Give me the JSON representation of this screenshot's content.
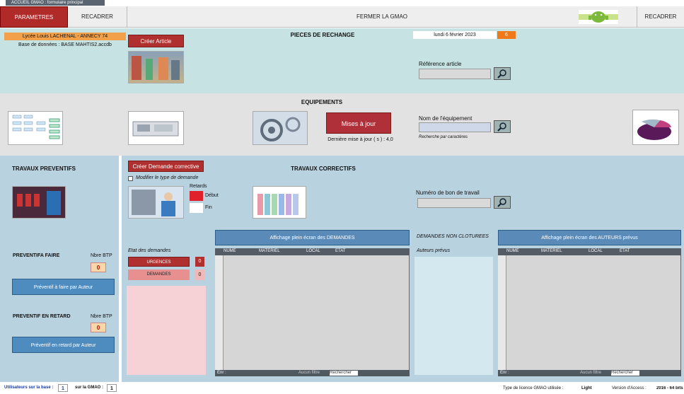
{
  "window": {
    "tab_title": "ACCUEIL GMAO : formulaire principal"
  },
  "topbar": {
    "parametres": "PARAMETRES",
    "recadrer_left": "RECADRER",
    "fermer": "FERMER LA GMAO",
    "recadrer_right": "RECADRER"
  },
  "header": {
    "school": "Lycée Louis LACHENAL - ANNECY 74",
    "db": "Base de données : BASE MAHTIS2.accdb",
    "date": "lundi 6 février 2023",
    "date_badge": "6"
  },
  "pieces": {
    "title": "PIECES DE RECHANGE",
    "create_btn": "Créer Article",
    "ref_label": "Référence article"
  },
  "equip": {
    "title": "EQUIPEMENTS",
    "maj_btn": "Mises à jour",
    "last_maj": "Dernière mise à jour ( s ) : 4,0",
    "nom_label": "Nom de l'équipement",
    "search_hint": "Recherche par caractères"
  },
  "preventifs": {
    "title": "TRAVAUX PREVENTIFS",
    "afaire_title": "PREVENTIFA FAIRE",
    "nbre_btp_1": "Nbre BTP",
    "count_1": "0",
    "afaire_btn": "Préventif à faire par Auteur",
    "retard_title": "PREVENTIF EN RETARD",
    "nbre_btp_2": "Nbre BTP",
    "count_2": "0",
    "retard_btn": "Préventif en retard par Auteur"
  },
  "correctifs": {
    "title": "TRAVAUX CORRECTIFS",
    "create_btn": "Créer Demande corrective",
    "modify_label": "Modifier le type de demande",
    "retards": "Retards",
    "debut": "Début",
    "fin": "Fin",
    "bon_label": "Numéro de bon de travail",
    "etat_label": "Etat des demandes",
    "urgences": "URGENCES",
    "urgences_count": "0",
    "demandes": "DEMANDES",
    "demandes_count": "0"
  },
  "demandes_grid": {
    "header_btn": "Affichage plein écran des DEMANDES",
    "cols": [
      "NUME",
      "MATERIEL",
      "LOCAL",
      "ETAT"
    ],
    "nav": "Enr :",
    "filter": "Aucun filtre",
    "search": "Rechercher"
  },
  "non_clot": {
    "title": "DEMANDES NON CLOTUREES",
    "auteurs": "Auteurs prévus"
  },
  "auteurs_grid": {
    "header_btn": "Affichage plein écran des AUTEURS prévus",
    "cols": [
      "NUME",
      "MATERIEL",
      "LOCAL",
      "ETAT"
    ],
    "nav": "Enr :",
    "filter": "Aucun filtre",
    "search": "Rechercher"
  },
  "status": {
    "users_base_label": "Utilisateurs sur la base :",
    "users_base": "1",
    "users_gmao_label": "sur la GMAO :",
    "users_gmao": "1",
    "licence_label": "Type de licence GMAO utilisée :",
    "licence": "Light",
    "version_label": "Version d'Access :",
    "version": "2016 - 64 bits"
  }
}
